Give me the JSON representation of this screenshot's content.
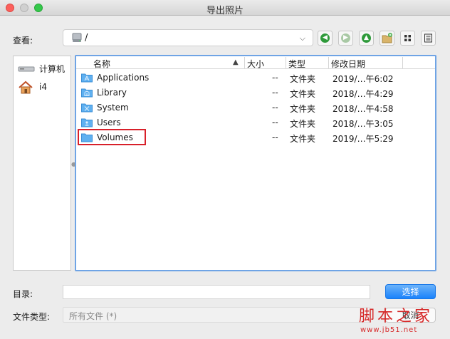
{
  "window": {
    "title": "导出照片"
  },
  "toolbar": {
    "look_in_label": "查看:",
    "path": "/",
    "buttons": [
      {
        "name": "back",
        "icon": "arrow-left-circle-icon",
        "color": "#2e9a3a"
      },
      {
        "name": "forward",
        "icon": "arrow-right-circle-icon",
        "color": "#a9c9a5"
      },
      {
        "name": "up",
        "icon": "arrow-up-circle-icon",
        "color": "#2e9a3a"
      },
      {
        "name": "new-folder",
        "icon": "new-folder-icon"
      },
      {
        "name": "icon-view",
        "icon": "grid-view-icon"
      },
      {
        "name": "detail-view",
        "icon": "list-view-icon"
      }
    ]
  },
  "sidebar": {
    "items": [
      {
        "label": "计算机",
        "icon": "computer-icon"
      },
      {
        "label": "i4",
        "icon": "home-icon"
      }
    ]
  },
  "file_list": {
    "columns": [
      "名称",
      "大小",
      "类型",
      "修改日期"
    ],
    "sort_indicator": "▲",
    "rows": [
      {
        "name": "Applications",
        "size": "--",
        "type": "文件夹",
        "date": "2019/…午6:02",
        "icon": "applications-folder-icon"
      },
      {
        "name": "Library",
        "size": "--",
        "type": "文件夹",
        "date": "2018/…午4:29",
        "icon": "library-folder-icon"
      },
      {
        "name": "System",
        "size": "--",
        "type": "文件夹",
        "date": "2018/…午4:58",
        "icon": "system-folder-icon"
      },
      {
        "name": "Users",
        "size": "--",
        "type": "文件夹",
        "date": "2018/…午3:05",
        "icon": "users-folder-icon"
      },
      {
        "name": "Volumes",
        "size": "--",
        "type": "文件夹",
        "date": "2019/…午5:29",
        "icon": "folder-icon"
      }
    ]
  },
  "footer": {
    "directory_label": "目录:",
    "directory_value": "",
    "choose_label": "选择",
    "file_type_label": "文件类型:",
    "file_type_value": "所有文件 (*)",
    "cancel_label": "取消"
  },
  "watermark": {
    "line1": "脚本之家",
    "line2": "www.jb51.net"
  },
  "colors": {
    "accent": "#1a82fb",
    "highlight_box": "#d8202a",
    "folder": "#5fb0f0"
  }
}
